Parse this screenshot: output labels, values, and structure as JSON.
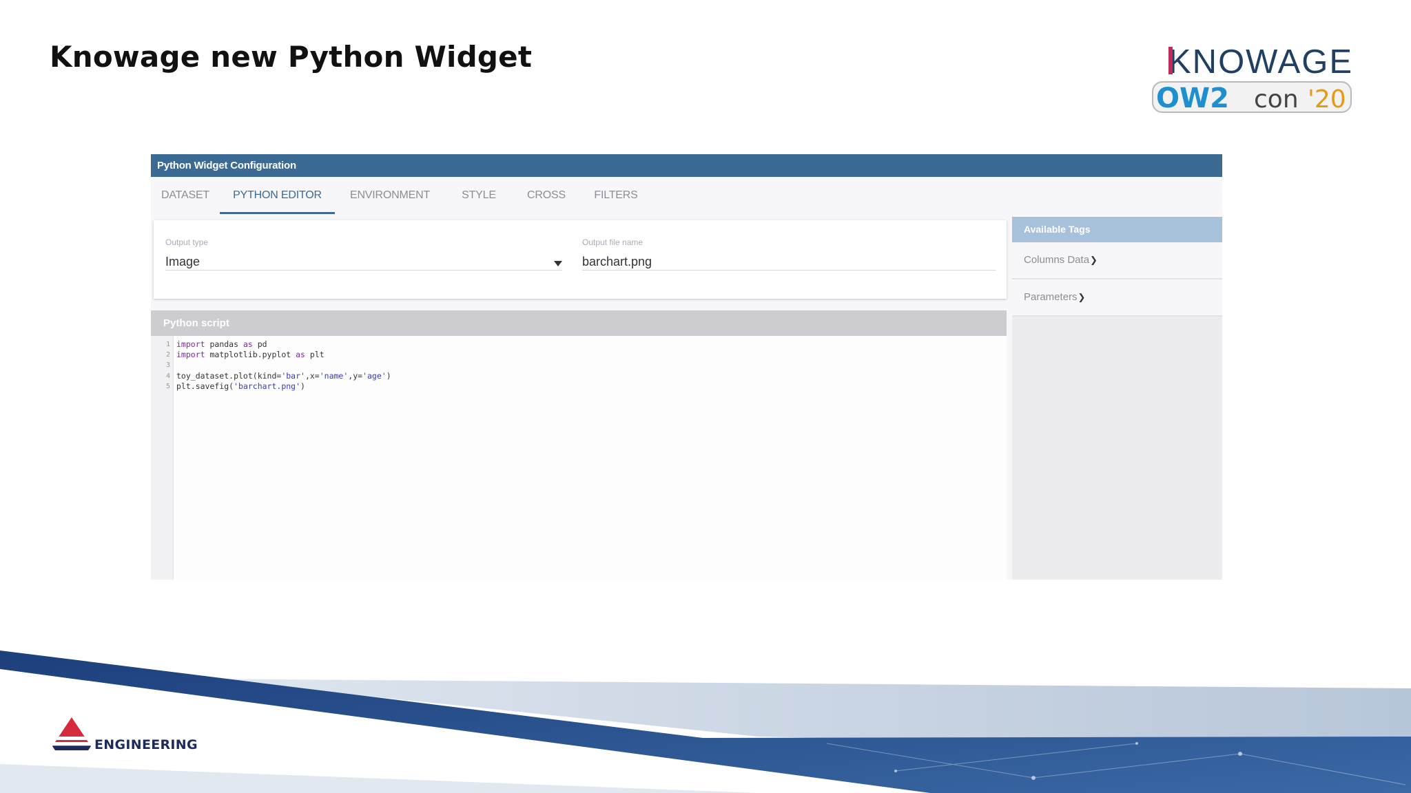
{
  "slide": {
    "title": "Knowage new Python Widget"
  },
  "logos": {
    "knowage": "KNOWAGE",
    "ow2con": "OW2con'20",
    "engineering": "ENGINEERING"
  },
  "dialog": {
    "title": "Python Widget Configuration",
    "tabs": [
      {
        "label": "DATASET",
        "active": false
      },
      {
        "label": "PYTHON EDITOR",
        "active": true
      },
      {
        "label": "ENVIRONMENT",
        "active": false
      },
      {
        "label": "STYLE",
        "active": false
      },
      {
        "label": "CROSS",
        "active": false
      },
      {
        "label": "FILTERS",
        "active": false
      }
    ],
    "output_type": {
      "label": "Output type",
      "value": "Image"
    },
    "output_file": {
      "label": "Output file name",
      "value": "barchart.png"
    },
    "script": {
      "title": "Python script",
      "line_numbers": [
        "1",
        "2",
        "3",
        "4",
        "5"
      ]
    },
    "tags": {
      "title": "Available Tags",
      "items": [
        "Columns Data",
        "Parameters"
      ]
    }
  },
  "colors": {
    "header_blue": "#3b6a94",
    "tags_header": "#a7c1da",
    "footer_navy": "#1a3a78"
  }
}
